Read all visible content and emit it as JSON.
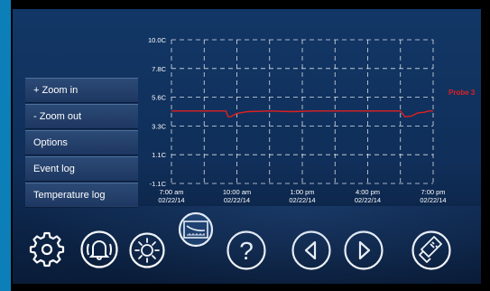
{
  "menu": {
    "zoom_in": "+ Zoom in",
    "zoom_out": "-  Zoom out",
    "options": "Options",
    "event_log": "Event log",
    "temperature_log": "Temperature log"
  },
  "chart_data": {
    "type": "line",
    "y_ticks": [
      "10.0C",
      "7.8C",
      "5.6C",
      "3.3C",
      "1.1C",
      "-1.1C"
    ],
    "ylim": [
      -1.1,
      10.0
    ],
    "x_ticks": [
      {
        "time": "7:00 am",
        "date": "02/22/14"
      },
      {
        "time": "10:00 am",
        "date": "02/22/14"
      },
      {
        "time": "1:00 pm",
        "date": "02/22/14"
      },
      {
        "time": "4:00 pm",
        "date": "02/22/14"
      },
      {
        "time": "7:00 pm",
        "date": "02/22/14"
      }
    ],
    "grid": true,
    "series": [
      {
        "name": "Probe 3",
        "color": "#e02020",
        "x_hours": [
          0,
          2.5,
          2.6,
          2.7,
          3.0,
          3.3,
          3.5,
          4.5,
          5.5,
          6.5,
          7.5,
          8.5,
          9.5,
          10.0,
          10.3,
          10.5,
          10.7,
          11.0,
          11.3,
          11.6,
          11.8,
          12.0
        ],
        "values": [
          4.5,
          4.5,
          4.05,
          4.05,
          4.3,
          4.4,
          4.45,
          4.5,
          4.45,
          4.5,
          4.5,
          4.5,
          4.5,
          4.5,
          4.5,
          4.5,
          4.05,
          4.1,
          4.35,
          4.4,
          4.5,
          4.5
        ]
      }
    ]
  },
  "toolbar": {
    "icons": [
      "gear-icon",
      "bell-icon",
      "sun-icon",
      "chart-icon",
      "help-icon",
      "left-arrow-icon",
      "right-arrow-icon",
      "usb-icon"
    ]
  },
  "colors": {
    "background": "#123766",
    "series": "#e02020",
    "accent": "#0d7fb8"
  }
}
